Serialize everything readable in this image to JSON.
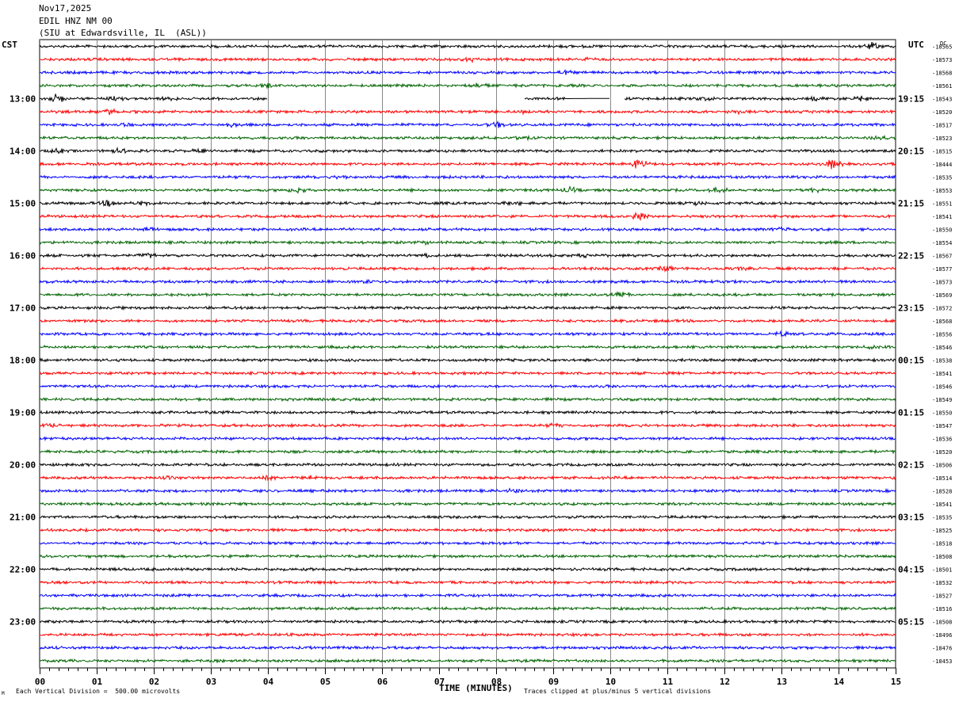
{
  "header": {
    "date": "Nov17,2025",
    "station": "EDIL HNZ NM 00",
    "site": "(SIU at Edwardsville, IL  (ASL))"
  },
  "corner_left": "CST",
  "corner_right": "UTC",
  "footer": {
    "scale_note": "Each Vertical Division =  500.00 microvolts",
    "clip_note": "Traces clipped at plus/minus 5 vertical divisions",
    "corner_mark": "M"
  },
  "chart_data": {
    "type": "line",
    "title": "",
    "xlabel": "TIME (MINUTES)",
    "ylabel": "",
    "xlim": [
      0,
      15
    ],
    "x_ticks": [
      "00",
      "01",
      "02",
      "03",
      "04",
      "05",
      "06",
      "07",
      "08",
      "09",
      "10",
      "11",
      "12",
      "13",
      "14",
      "15"
    ],
    "grid": true,
    "left_hour_labels": [
      "13:00",
      "14:00",
      "15:00",
      "16:00",
      "17:00",
      "18:00",
      "19:00",
      "20:00",
      "21:00",
      "22:00",
      "23:00"
    ],
    "right_utc_labels": [
      "19:15",
      "20:15",
      "21:15",
      "22:15",
      "23:15",
      "00:15",
      "01:15",
      "02:15",
      "03:15",
      "04:15",
      "05:15"
    ],
    "trace_colors": [
      "#000000",
      "#ff0000",
      "#0000ff",
      "#006400"
    ],
    "right_top_label": "DC",
    "trace_offsets": [
      -18565,
      -18573,
      -18568,
      -18561,
      -18543,
      -18520,
      -18517,
      -18523,
      -18515,
      -18444,
      -18535,
      -18553,
      -18551,
      -18541,
      -18550,
      -18554,
      -18567,
      -18577,
      -18573,
      -18569,
      -18572,
      -18568,
      -18556,
      -18546,
      -18538,
      -18541,
      -18546,
      -18549,
      -18550,
      -18547,
      -18536,
      -18520,
      -18506,
      -18514,
      -18528,
      -18541,
      -18535,
      -18525,
      -18518,
      -18508,
      -18501,
      -18532,
      -18527,
      -18516,
      -18508,
      -18496,
      -18476,
      -18453
    ],
    "trace_activity": [
      [
        [
          14.6,
          2.5
        ]
      ],
      [
        [
          7.6,
          1.2
        ],
        [
          9.6,
          1.2
        ]
      ],
      [
        [
          9.2,
          1.0
        ]
      ],
      [
        [
          4.0,
          1.2
        ],
        [
          7.7,
          1.5
        ]
      ],
      [
        [
          0.3,
          3.0
        ],
        [
          1.3,
          2.0
        ],
        [
          2.3,
          1.5
        ],
        [
          11.6,
          1.2
        ],
        [
          13.6,
          1.2
        ],
        [
          14.4,
          1.2
        ]
      ],
      [
        [
          1.2,
          2.0
        ],
        [
          8.5,
          1.2
        ],
        [
          12.2,
          1.0
        ]
      ],
      [
        [
          1.5,
          1.5
        ],
        [
          3.4,
          1.5
        ],
        [
          8.0,
          2.0
        ]
      ],
      [
        [
          14.7,
          1.5
        ],
        [
          8.5,
          1.0
        ]
      ],
      [
        [
          0.3,
          1.5
        ],
        [
          1.4,
          1.5
        ],
        [
          2.8,
          1.0
        ]
      ],
      [
        [
          10.5,
          4.5
        ],
        [
          13.9,
          4.0
        ]
      ],
      [
        [
          5.3,
          1.0
        ]
      ],
      [
        [
          4.5,
          1.8
        ],
        [
          9.3,
          2.0
        ],
        [
          11.9,
          2.5
        ],
        [
          13.6,
          1.5
        ]
      ],
      [
        [
          1.2,
          2.0
        ],
        [
          1.8,
          1.5
        ],
        [
          8.3,
          1.2
        ],
        [
          11.5,
          1.0
        ]
      ],
      [
        [
          10.5,
          3.0
        ]
      ],
      [
        [
          1.9,
          1.0
        ],
        [
          13.0,
          1.0
        ]
      ],
      [
        [
          6.8,
          1.0
        ]
      ],
      [
        [
          1.9,
          1.5
        ],
        [
          6.8,
          1.2
        ],
        [
          9.6,
          1.0
        ]
      ],
      [
        [
          11.0,
          2.0
        ],
        [
          12.3,
          1.0
        ]
      ],
      [
        [
          5.8,
          1.0
        ]
      ],
      [
        [
          10.2,
          1.2
        ]
      ],
      [],
      [],
      [
        [
          13.0,
          1.2
        ]
      ],
      [
        [
          14.5,
          1.2
        ]
      ],
      [],
      [],
      [],
      [],
      [],
      [
        [
          0.2,
          1.2
        ],
        [
          9.0,
          1.0
        ]
      ],
      [],
      [],
      [],
      [
        [
          2.3,
          1.5
        ],
        [
          4.0,
          1.5
        ],
        [
          4.7,
          1.2
        ]
      ],
      [
        [
          8.3,
          1.0
        ]
      ],
      [],
      [],
      [],
      [],
      [],
      [],
      [],
      [],
      [],
      [],
      [],
      [],
      []
    ],
    "gaps": [
      {
        "trace": 4,
        "from": 4.0,
        "to": 8.5
      },
      {
        "trace": 4,
        "from": 10.0,
        "to": 10.25
      }
    ],
    "flatlines": [
      {
        "trace": 4,
        "from": 9.2,
        "to": 10.0
      }
    ]
  }
}
